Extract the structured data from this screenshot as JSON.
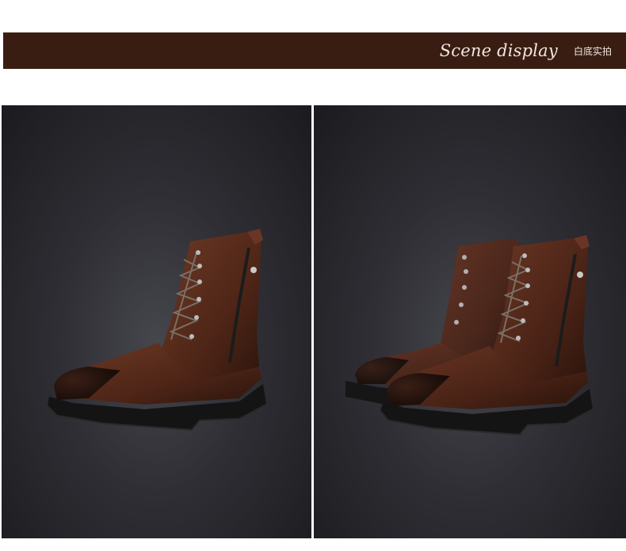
{
  "banner": {
    "title": "Scene display",
    "subtitle": "白底实拍"
  },
  "colors": {
    "banner_bg": "#3a1d12",
    "panel_bg": "#2e2e34",
    "leather": "#5b2e1e",
    "sole": "#141414"
  },
  "images": [
    {
      "name": "single-boot-photo",
      "depicts": "brown leather lace-up ankle boot with side zipper"
    },
    {
      "name": "boot-pair-photo",
      "depicts": "pair of brown leather lace-up ankle boots"
    }
  ]
}
